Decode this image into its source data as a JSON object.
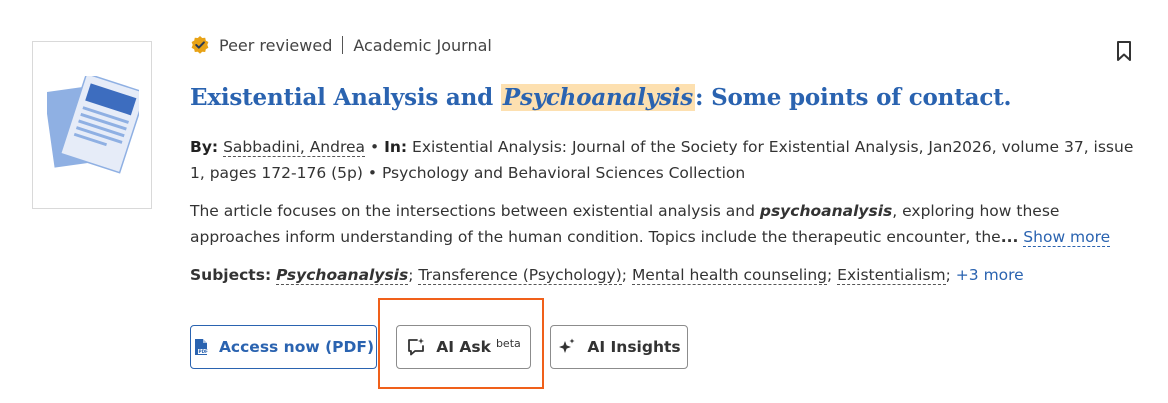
{
  "result": {
    "peer_reviewed": "Peer reviewed",
    "source_type": "Academic Journal",
    "title_before": "Existential Analysis and ",
    "title_highlight": "Psychoanalysis",
    "title_after": ": Some points of contact.",
    "by_label": "By:",
    "author": "Sabbadini, Andrea",
    "in_label": "In:",
    "source_detail": "Existential Analysis: Journal of the Society for Existential Analysis, Jan2026, volume 37, issue 1, pages 172-176 (5p)",
    "collection": "Psychology and Behavioral Sciences Collection",
    "abstract_before": "The article focuses on the intersections between existential analysis and ",
    "abstract_highlight": "psychoanalysis",
    "abstract_after": ", exploring how these approaches inform understanding of the human condition. Topics include the therapeutic encounter, the",
    "ellipsis": "...",
    "show_more": "Show more",
    "subjects_label": "Subjects:",
    "subjects": [
      "Psychoanalysis",
      "Transference (Psychology)",
      "Mental health counseling",
      "Existentialism"
    ],
    "more_subjects": "+3 more"
  },
  "actions": {
    "access_pdf": "Access now (PDF)",
    "ai_ask": "AI Ask",
    "ai_ask_badge": "beta",
    "ai_insights": "AI Insights"
  },
  "icons": {
    "thumbnail": "document-icon",
    "peer_badge": "check-badge-icon",
    "bookmark": "bookmark-icon",
    "pdf": "pdf-icon",
    "ai_ask": "chat-sparkle-icon",
    "ai_insights": "sparkle-icon"
  },
  "colors": {
    "link": "#2a63b0",
    "highlight": "#fde0b0",
    "badge": "#e8a317",
    "focus_outline": "#f0601a"
  }
}
